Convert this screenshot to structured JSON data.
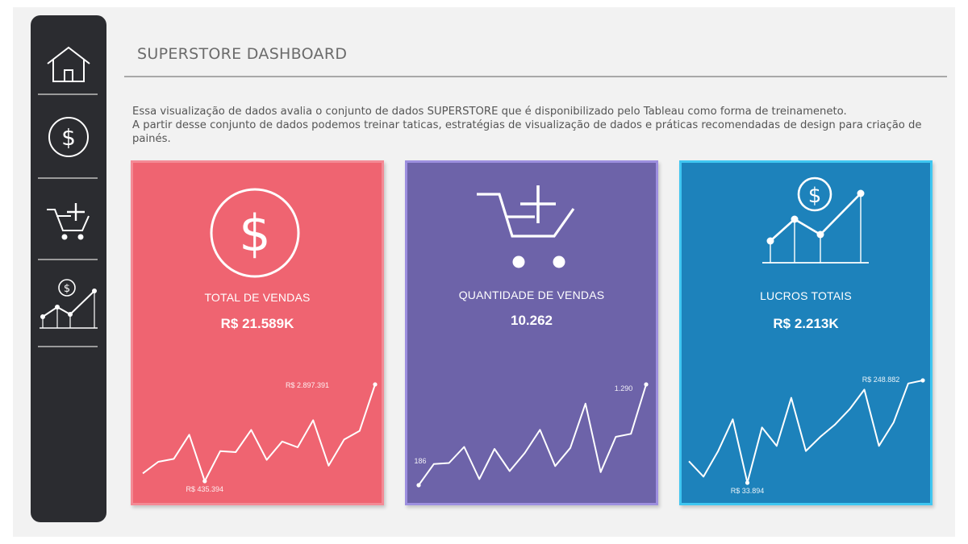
{
  "dashboard": {
    "title": "SUPERSTORE DASHBOARD",
    "description_line1": "Essa visualização de dados avalia o conjunto de dados SUPERSTORE que é disponibilizado pelo Tableau como forma de treinameneto.",
    "description_line2": "A partir desse conjunto de dados podemos treinar taticas, estratégias de visualização de dados e práticas recomendadas de design para criação de painés."
  },
  "sidebar": {
    "items": [
      {
        "icon": "home-icon"
      },
      {
        "icon": "dollar-circle-icon"
      },
      {
        "icon": "cart-plus-icon"
      },
      {
        "icon": "chart-dollar-icon"
      }
    ]
  },
  "cards": [
    {
      "label": "TOTAL DE VENDAS",
      "value": "R$ 21.589K",
      "icon": "dollar-circle-icon",
      "bg": "#ef6471",
      "border": "#f48a95",
      "max_label": "R$ 2.897.391",
      "min_label": "R$ 435.394"
    },
    {
      "label": "QUANTIDADE DE VENDAS",
      "value": "10.262",
      "icon": "cart-plus-icon",
      "bg": "#6d63a9",
      "border": "#9d8fdf",
      "max_label": "1.290",
      "min_label": "186"
    },
    {
      "label": "LUCROS TOTAIS",
      "value": "R$ 2.213K",
      "icon": "chart-dollar-icon",
      "bg": "#1d82bb",
      "border": "#3fc6f1",
      "max_label": "R$ 248.882",
      "min_label": "R$ 33.894"
    }
  ],
  "chart_data": [
    {
      "type": "line",
      "title": "TOTAL DE VENDAS",
      "values": [
        0.08,
        0.2,
        0.23,
        0.48,
        0.0,
        0.31,
        0.3,
        0.53,
        0.22,
        0.41,
        0.35,
        0.63,
        0.16,
        0.43,
        0.52,
        1.0
      ],
      "min_label": "R$ 435.394",
      "max_label": "R$ 2.897.391"
    },
    {
      "type": "line",
      "title": "QUANTIDADE DE VENDAS",
      "values": [
        0.0,
        0.21,
        0.22,
        0.38,
        0.06,
        0.36,
        0.14,
        0.32,
        0.55,
        0.19,
        0.37,
        0.81,
        0.13,
        0.48,
        0.51,
        1.0
      ],
      "min_label": "186",
      "max_label": "1.290"
    },
    {
      "type": "line",
      "title": "LUCROS TOTAIS",
      "values": [
        0.21,
        0.06,
        0.31,
        0.62,
        0.0,
        0.54,
        0.36,
        0.83,
        0.31,
        0.45,
        0.57,
        0.72,
        0.91,
        0.36,
        0.59,
        0.97,
        1.0
      ],
      "min_label": "R$ 33.894",
      "max_label": "R$ 248.882"
    }
  ]
}
